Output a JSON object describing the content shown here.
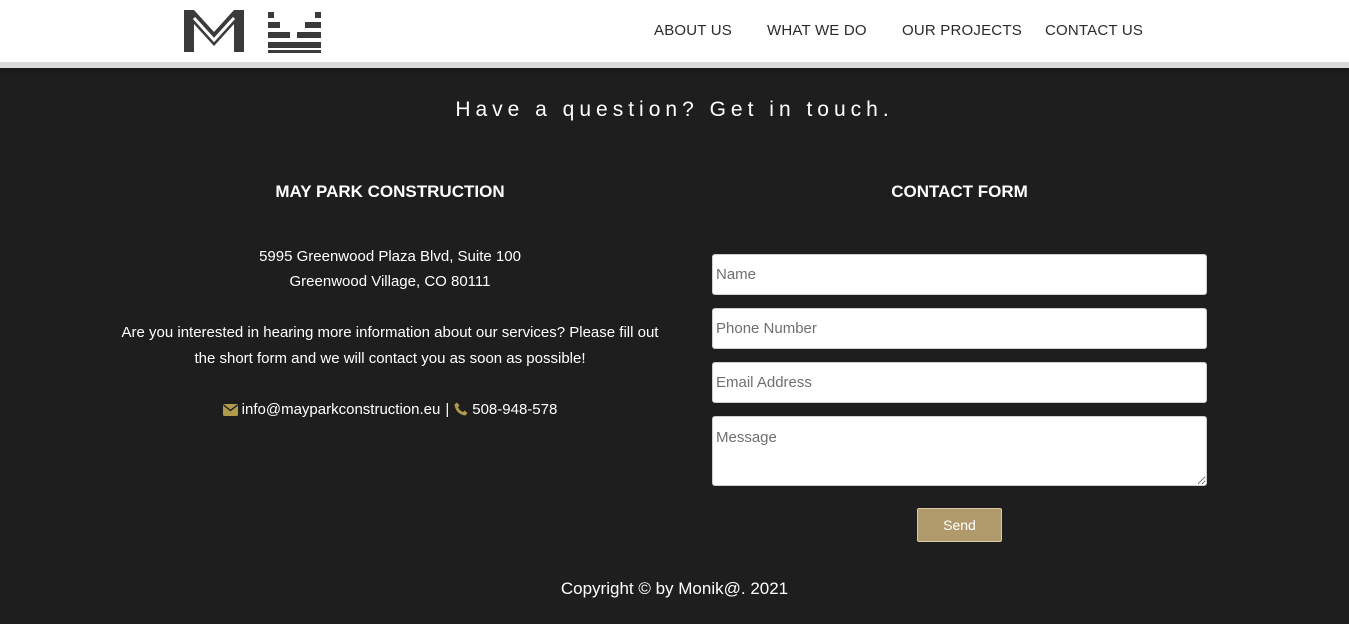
{
  "header": {
    "logo": "logo-icon",
    "nav": [
      "ABOUT US",
      "WHAT WE DO",
      "OUR PROJECTS",
      "CONTACT US"
    ]
  },
  "section": {
    "headline": "Have a question? Get in touch."
  },
  "company": {
    "title": "MAY PARK CONSTRUCTION",
    "address_line1": "5995 Greenwood Plaza Blvd, Suite 100",
    "address_line2": "Greenwood Village, CO 80111",
    "blurb_line1": "Are you interested in hearing more information about our services? Please fill out",
    "blurb_line2": "the short form and we will contact you as soon as possible!",
    "email": "info@mayparkconstruction.eu",
    "separator": "|",
    "phone": "508-948-578",
    "accent_color": "#b19a4c"
  },
  "form": {
    "title": "CONTACT FORM",
    "name_placeholder": "Name",
    "phone_placeholder": "Phone Number",
    "email_placeholder": "Email Address",
    "message_placeholder": "Message",
    "send_label": "Send",
    "button_color": "#b09a6c"
  },
  "footer": {
    "copyright": "Copyright © by Monik@. 2021"
  }
}
